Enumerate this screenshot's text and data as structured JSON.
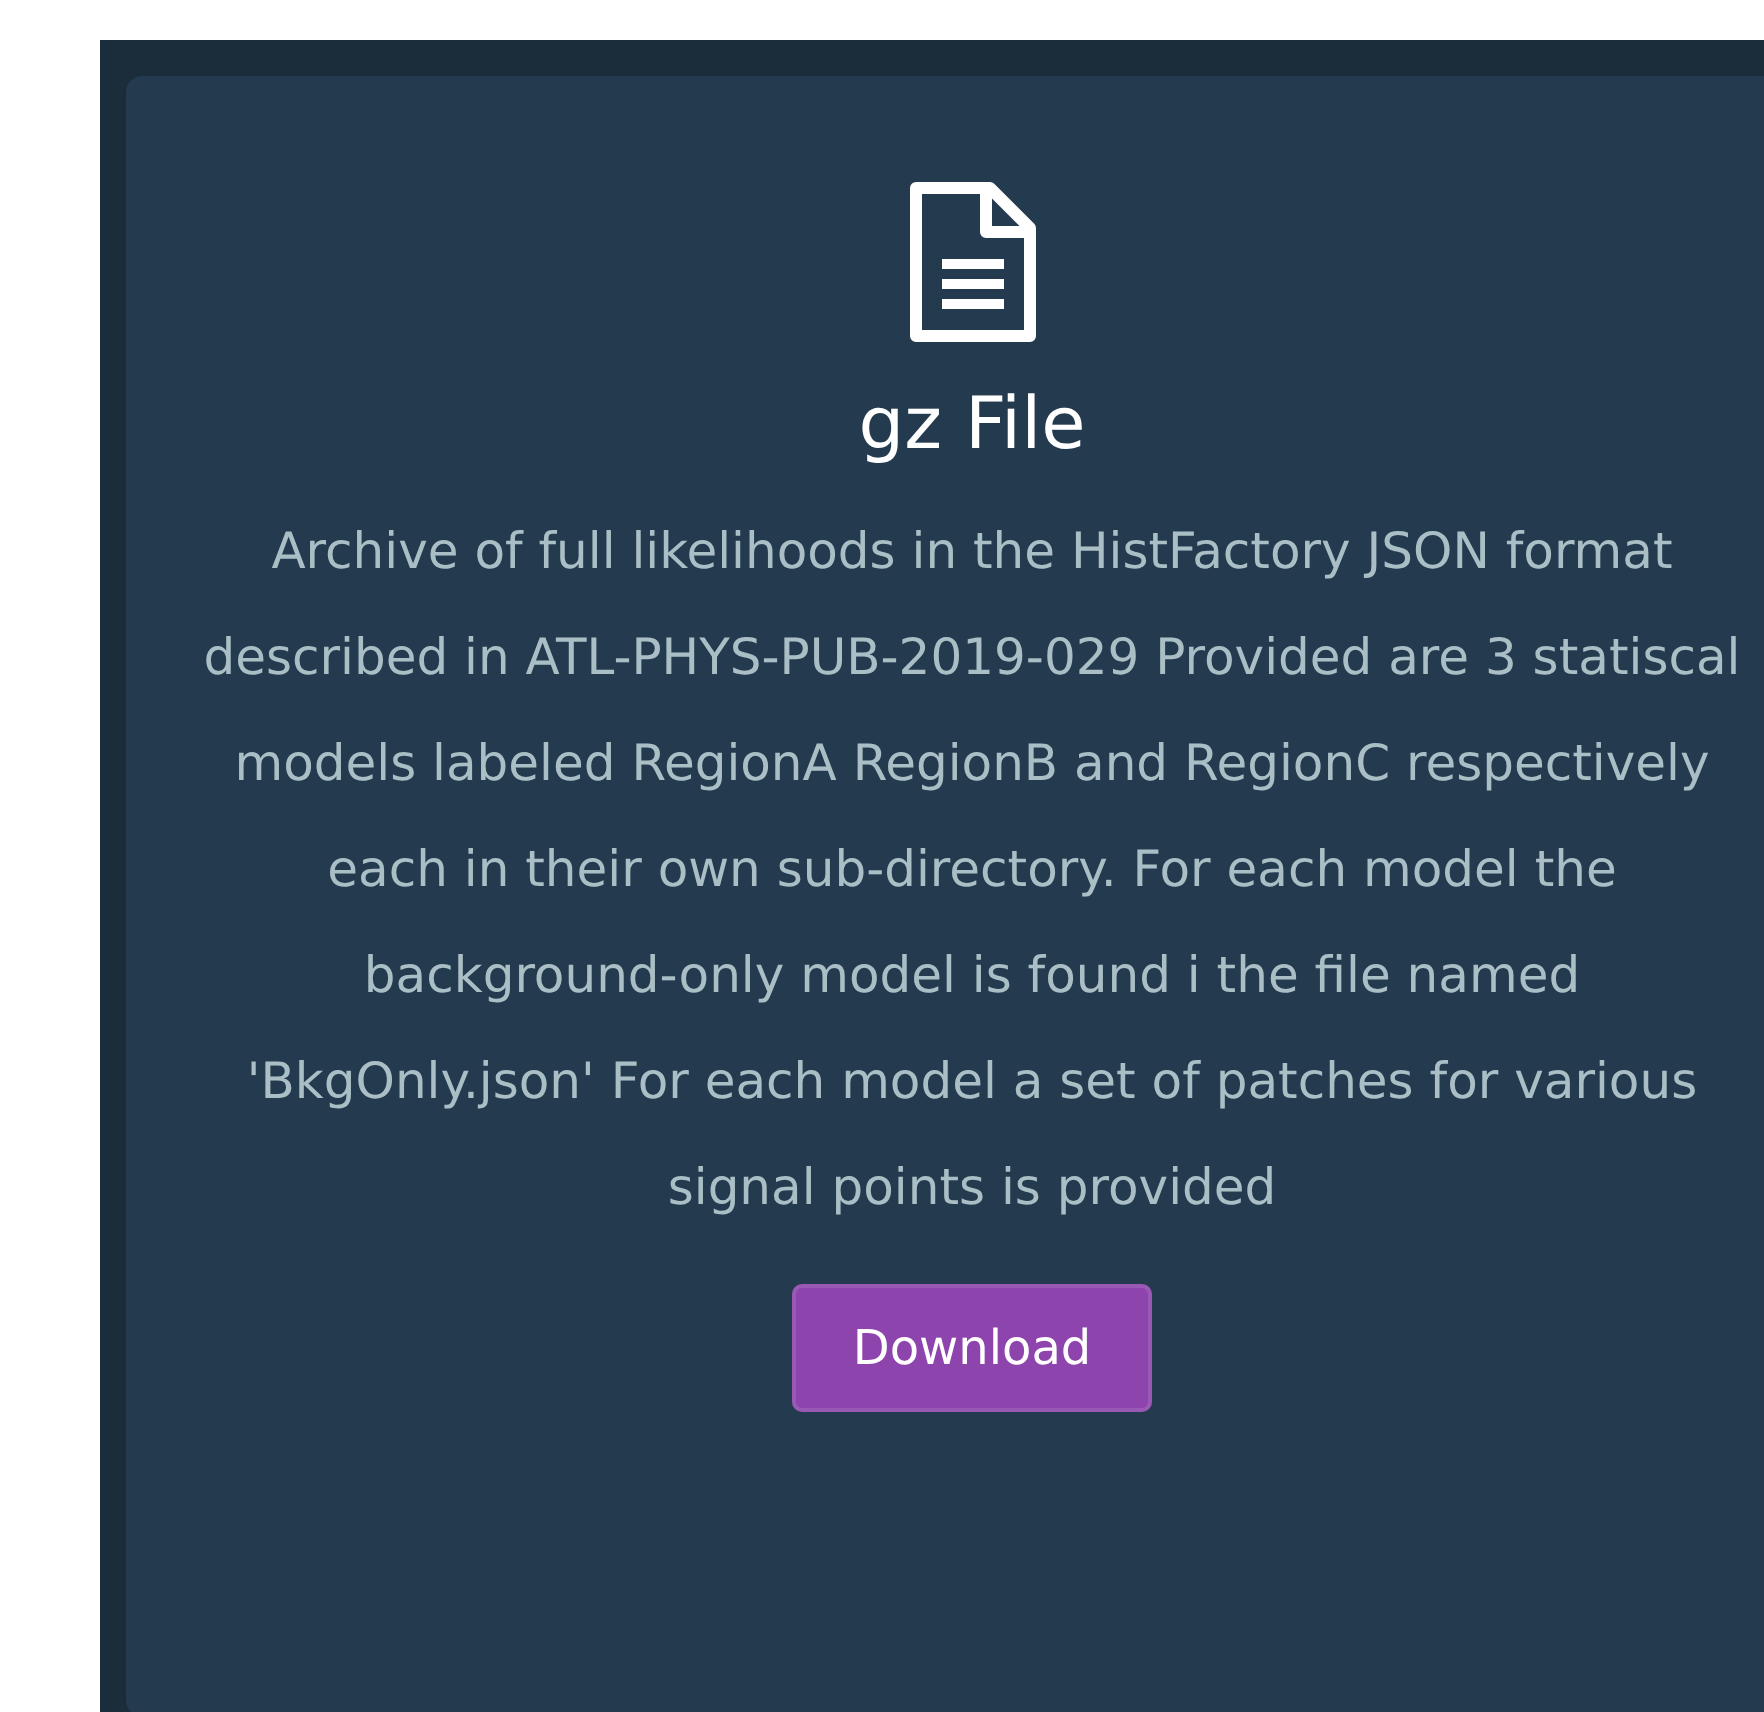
{
  "card": {
    "title": "gz File",
    "description": "Archive of full likelihoods in the HistFactory JSON format described in ATL-PHYS-PUB-2019-029 Provided are 3 statiscal models labeled RegionA RegionB and RegionC respectively each in their own sub-directory. For each model the background-only model is found i the file named 'BkgOnly.json' For each model a set of patches for various signal points is provided",
    "button": "Download"
  }
}
